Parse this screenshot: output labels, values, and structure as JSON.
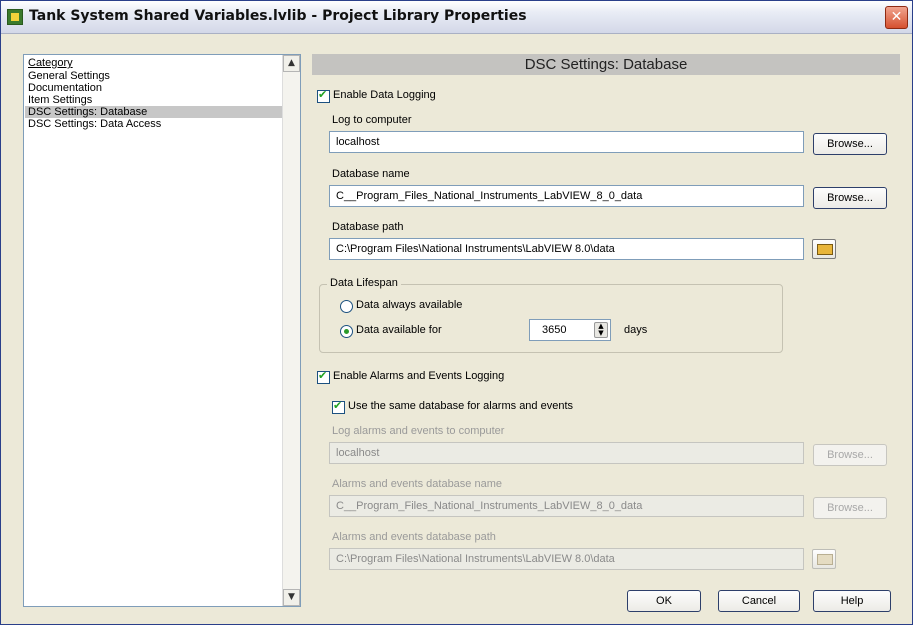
{
  "window": {
    "title": "Tank System Shared Variables.lvlib - Project Library Properties",
    "close_glyph": "✕"
  },
  "category": {
    "header": "Category",
    "items": [
      {
        "label": "General Settings"
      },
      {
        "label": "Documentation"
      },
      {
        "label": "Item Settings"
      },
      {
        "label": "DSC Settings: Database",
        "selected": true
      },
      {
        "label": "DSC Settings: Data Access"
      }
    ],
    "scroll_up_glyph": "▲",
    "scroll_down_glyph": "▼"
  },
  "section_title": "DSC Settings: Database",
  "logging": {
    "enable_label": "Enable Data Logging",
    "enable_checked": true,
    "computer_label": "Log to computer",
    "computer_value": "localhost",
    "db_name_label": "Database name",
    "db_name_value": "C__Program_Files_National_Instruments_LabVIEW_8_0_data",
    "db_path_label": "Database path",
    "db_path_value": "C:\\Program Files\\National Instruments\\LabVIEW 8.0\\data",
    "browse_label": "Browse..."
  },
  "lifespan": {
    "group_title": "Data Lifespan",
    "always_label": "Data always available",
    "available_for_label": "Data available for",
    "selected_option": "available_for",
    "days_value": "3650",
    "days_label": "days"
  },
  "alarms": {
    "enable_label": "Enable Alarms and Events Logging",
    "enable_checked": true,
    "same_db_label": "Use the same database for alarms and events",
    "same_db_checked": true,
    "computer_label": "Log alarms and events to computer",
    "computer_value": "localhost",
    "db_name_label": "Alarms and events database name",
    "db_name_value": "C__Program_Files_National_Instruments_LabVIEW_8_0_data",
    "db_path_label": "Alarms and events database path",
    "db_path_value": "C:\\Program Files\\National Instruments\\LabVIEW 8.0\\data",
    "browse_label": "Browse..."
  },
  "buttons": {
    "ok": "OK",
    "cancel": "Cancel",
    "help": "Help"
  },
  "icons": {
    "app": "labview-project-library-icon",
    "close": "close-icon",
    "folder": "folder-icon"
  }
}
